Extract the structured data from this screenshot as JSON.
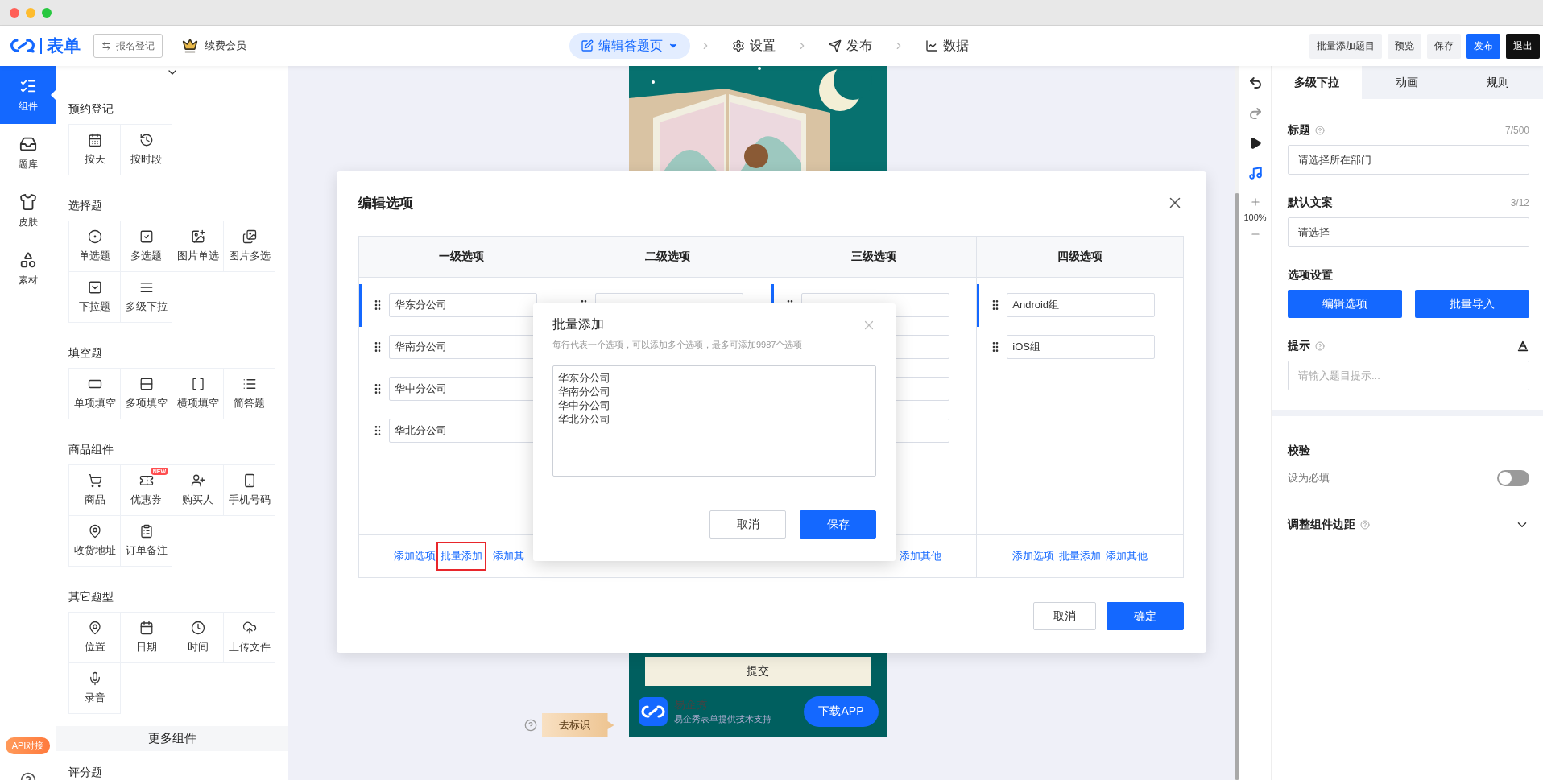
{
  "header": {
    "logo_text": "表单",
    "form_button": "报名登记",
    "member_link": "续费会员",
    "steps": [
      {
        "label": "编辑答题页",
        "selected": true
      },
      {
        "label": "设置",
        "selected": false
      },
      {
        "label": "发布",
        "selected": false
      },
      {
        "label": "数据",
        "selected": false
      }
    ],
    "actions": [
      {
        "label": "批量添加题目",
        "kind": "default"
      },
      {
        "label": "预览",
        "kind": "default"
      },
      {
        "label": "保存",
        "kind": "default"
      },
      {
        "label": "发布",
        "kind": "primary"
      },
      {
        "label": "退出",
        "kind": "dark"
      }
    ]
  },
  "rail": {
    "items": [
      {
        "label": "组件",
        "selected": true
      },
      {
        "label": "题库",
        "selected": false
      },
      {
        "label": "皮肤",
        "selected": false
      },
      {
        "label": "素材",
        "selected": false
      }
    ],
    "badge": "API对接"
  },
  "sidebar": {
    "sections": [
      {
        "title": "预约登记",
        "items": [
          {
            "label": "按天"
          },
          {
            "label": "按时段"
          }
        ]
      },
      {
        "title": "选择题",
        "items": [
          {
            "label": "单选题"
          },
          {
            "label": "多选题"
          },
          {
            "label": "图片单选"
          },
          {
            "label": "图片多选"
          },
          {
            "label": "下拉题"
          },
          {
            "label": "多级下拉"
          }
        ]
      },
      {
        "title": "填空题",
        "items": [
          {
            "label": "单项填空"
          },
          {
            "label": "多项填空"
          },
          {
            "label": "横项填空"
          },
          {
            "label": "简答题"
          }
        ]
      },
      {
        "title": "商品组件",
        "items": [
          {
            "label": "商品"
          },
          {
            "label": "优惠券",
            "badge": "NEW"
          },
          {
            "label": "购买人"
          },
          {
            "label": "手机号码"
          },
          {
            "label": "收货地址"
          },
          {
            "label": "订单备注"
          }
        ]
      },
      {
        "title": "其它题型",
        "items": [
          {
            "label": "位置"
          },
          {
            "label": "日期"
          },
          {
            "label": "时间"
          },
          {
            "label": "上传文件"
          },
          {
            "label": "录音"
          }
        ]
      }
    ],
    "more": "更多组件",
    "next_section": "评分题"
  },
  "preview": {
    "submit": "提交",
    "brand_name": "易企秀",
    "brand_line": "易企秀表单提供技术支持",
    "download": "下载APP",
    "remove_brand": "去标识"
  },
  "modal": {
    "title": "编辑选项",
    "columns": [
      {
        "heading": "一级选项",
        "options": [
          {
            "value": "华东分公司",
            "selected": true
          },
          {
            "value": "华南分公司",
            "selected": false
          },
          {
            "value": "华中分公司",
            "selected": false
          },
          {
            "value": "华北分公司",
            "selected": false
          }
        ],
        "links": [
          {
            "label": "添加选项",
            "highlighted": false
          },
          {
            "label": "批量添加",
            "highlighted": true
          },
          {
            "label": "添加其",
            "highlighted": false
          }
        ]
      },
      {
        "heading": "二级选项",
        "options": [
          {
            "selected": false
          }
        ]
      },
      {
        "heading": "三级选项",
        "options": [
          {
            "selected": true
          },
          {
            "selected": false
          },
          {
            "selected": false
          },
          {
            "selected": false
          }
        ],
        "links": [
          {
            "label": "添加其他",
            "highlighted": false
          }
        ]
      },
      {
        "heading": "四级选项",
        "options": [
          {
            "value": "Android组",
            "selected": true
          },
          {
            "value": "iOS组",
            "selected": false
          }
        ],
        "links": [
          {
            "label": "添加选项",
            "highlighted": false
          },
          {
            "label": "批量添加",
            "highlighted": false
          },
          {
            "label": "添加其他",
            "highlighted": false
          }
        ]
      }
    ],
    "buttons": [
      {
        "label": "取消",
        "kind": "default"
      },
      {
        "label": "确定",
        "kind": "primary"
      }
    ]
  },
  "batch_dialog": {
    "title": "批量添加",
    "hint": "每行代表一个选项，可以添加多个选项，最多可添加9987个选项",
    "lines": [
      "华东分公司",
      "华南分公司",
      "华中分公司",
      "华北分公司"
    ],
    "buttons": [
      {
        "label": "取消",
        "kind": "default"
      },
      {
        "label": "保存",
        "kind": "primary"
      }
    ]
  },
  "tools": {
    "zoom": "100%"
  },
  "panel": {
    "tabs": [
      {
        "label": "多级下拉",
        "selected": true
      },
      {
        "label": "动画",
        "selected": false
      },
      {
        "label": "规则",
        "selected": false
      }
    ],
    "title_field": {
      "label": "标题",
      "counter": "7/500",
      "value": "请选择所在部门"
    },
    "default_text": {
      "label": "默认文案",
      "counter": "3/12",
      "value": "请选择"
    },
    "option_settings": {
      "label": "选项设置",
      "buttons": [
        "编辑选项",
        "批量导入"
      ]
    },
    "hint": {
      "label": "提示",
      "placeholder": "请输入题目提示..."
    },
    "validation": {
      "label": "校验",
      "required_label": "设为必填",
      "required": false
    },
    "spacing": {
      "label": "调整组件边距",
      "expanded": false
    }
  }
}
